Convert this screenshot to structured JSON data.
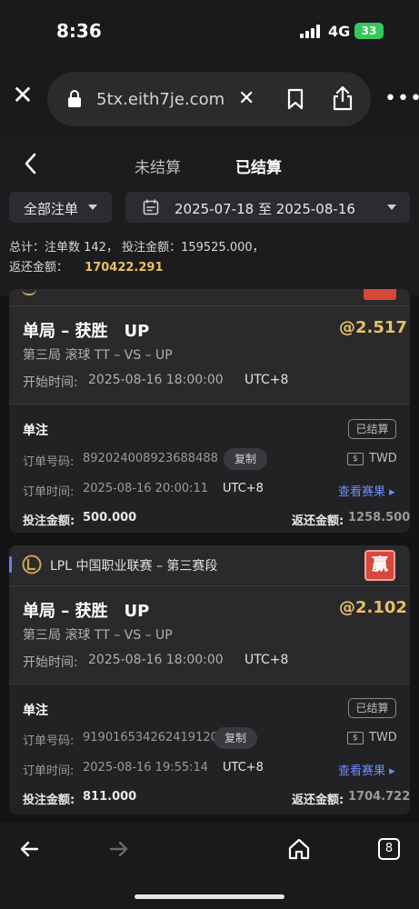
{
  "status": {
    "time": "8:36",
    "network": "4G",
    "battery": "33"
  },
  "browser": {
    "url": "5tx.eith7je.com"
  },
  "header": {
    "tab_unsettled": "未结算",
    "tab_settled": "已结算",
    "filter_type": "全部注单",
    "date_range": "2025-07-18 至 2025-08-16",
    "summary_line1": "总计：注单数 142， 投注金额：159525.000，",
    "summary_returned_label": "返还金额：",
    "summary_returned_value": "170422.291"
  },
  "cards": [
    {
      "title": "单局 – 获胜　UP",
      "odds": "@2.517",
      "sub": "第三局 滚球  TT – VS – UP",
      "start_label": "开始时间:",
      "start_value": "2025-08-16 18:00:00",
      "tz": "UTC+8",
      "bet_type": "单注",
      "status": "已结算",
      "order_no_label": "订单号码:",
      "order_no": "892024008923688488",
      "copy": "复制",
      "currency": "TWD",
      "order_time_label": "订单时间:",
      "order_time": "2025-08-16 20:00:11",
      "order_tz": "UTC+8",
      "view_result": "查看赛果",
      "stake_label": "投注金额:",
      "stake": "500.000",
      "return_label": "返还金额:",
      "return": "1258.500"
    },
    {
      "league": "LPL 中国职业联赛 – 第三赛段",
      "win_badge": "赢",
      "title": "单局 – 获胜　UP",
      "odds": "@2.102",
      "sub": "第三局 滚球  TT – VS – UP",
      "start_label": "开始时间:",
      "start_value": "2025-08-16 18:00:00",
      "tz": "UTC+8",
      "bet_type": "单注",
      "status": "已结算",
      "order_no_label": "订单号码:",
      "order_no": "919016534262419120",
      "copy": "复制",
      "currency": "TWD",
      "order_time_label": "订单时间:",
      "order_time": "2025-08-16 19:55:14",
      "order_tz": "UTC+8",
      "view_result": "查看赛果",
      "stake_label": "投注金额:",
      "stake": "811.000",
      "return_label": "返还金额:",
      "return": "1704.722"
    }
  ],
  "bottom_nav": {
    "tab_count": "8"
  }
}
